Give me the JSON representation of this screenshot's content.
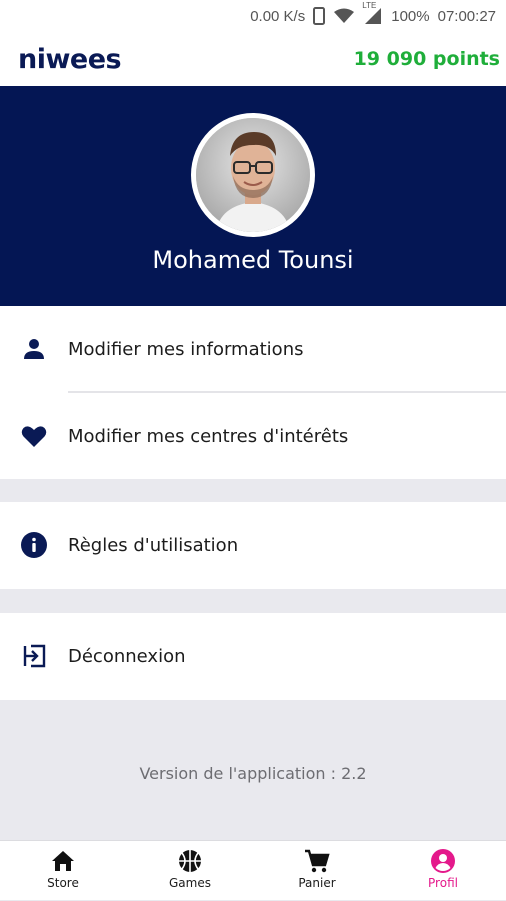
{
  "status_bar": {
    "network_speed": "0.00 K/s",
    "network_type": "LTE",
    "battery": "100%",
    "time": "07:00:27",
    "icons": [
      "phone-icon",
      "wifi-icon",
      "signal-icon"
    ]
  },
  "header": {
    "brand": "niwees",
    "points": "19 090 points",
    "points_color": "#1fae3a"
  },
  "profile": {
    "name": "Mohamed Tounsi",
    "banner_color": "#041654"
  },
  "menu": {
    "edit_info": "Modifier mes informations",
    "edit_interests": "Modifier mes centres d'intérêts",
    "rules": "Règles d'utilisation",
    "logout": "Déconnexion"
  },
  "footer": {
    "version": "Version de l'application : 2.2"
  },
  "bottom_nav": {
    "items": [
      {
        "label": "Store",
        "icon": "home-icon"
      },
      {
        "label": "Games",
        "icon": "basketball-icon"
      },
      {
        "label": "Panier",
        "icon": "cart-icon"
      },
      {
        "label": "Profil",
        "icon": "profile-icon"
      }
    ],
    "active": "Profil",
    "active_color": "#e4198b"
  }
}
